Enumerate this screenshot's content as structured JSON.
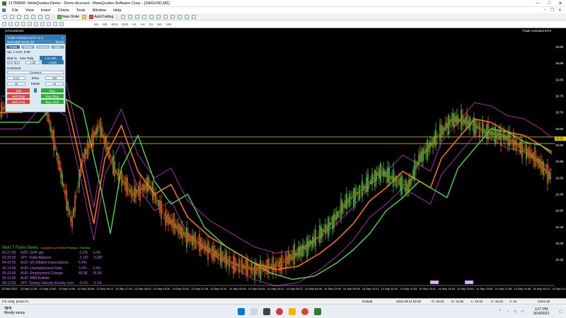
{
  "window": {
    "title": "11758965: MetaQuotes-Demo - Demo Account - MetaQuotes Software Corp. - [XAGUSD,M1]"
  },
  "menu": [
    "File",
    "View",
    "Insert",
    "Charts",
    "Tools",
    "Window",
    "Help"
  ],
  "toolbar": {
    "new_order": "New Order",
    "autotrading": "AutoTrading",
    "timeframes": [
      "M1",
      "M5",
      "M15",
      "M30",
      "H1",
      "H4",
      "D1",
      "W1",
      "MN"
    ]
  },
  "chart": {
    "symbol_label": "XAGUSD,M1",
    "assistant_label": "Trade Assistant MT4",
    "current_price_tag": "19.62",
    "price_labels": [
      "19.90",
      "19.85",
      "19.80",
      "19.75",
      "19.70",
      "19.65",
      "19.60",
      "19.55",
      "19.50",
      "19.45",
      "19.40",
      "19.35",
      "19.30",
      "19.25"
    ],
    "time_labels": [
      "13 Sep 2022",
      "13 Sep 11:00",
      "13 Sep 13:00",
      "13 Sep 14:04",
      "13 Sep 15:08",
      "13 Sep 16:12",
      "13 Sep 17:16",
      "13 Sep 18:20",
      "13 Sep 19:25",
      "13 Sep 20:31",
      "13 Sep 21:39",
      "13 Sep 22:47",
      "14 Sep 02:00",
      "14 Sep 03:04",
      "14 Sep 04:12",
      "14 Sep 05:27",
      "14 Sep 06:49",
      "14 Sep 07:59",
      "14 Sep 09:05",
      "14 Sep 10:13",
      "14 Sep 11:20",
      "14 Sep 12:33",
      "14 Sep 13:41",
      "14 Sep 14:45",
      "14 Sep 15:49",
      "14 Sep 16:53",
      "14 Sep 17:58",
      "14 Sep 19:05",
      "14 Sep 20:13",
      "14 Sep 21:21"
    ],
    "time_badges": [
      "08:30",
      "08:30"
    ],
    "colors": {
      "background": "#000000",
      "bull": "#4cd94c",
      "bear": "#ff6a1a",
      "ma_fast": "#ff6a1a",
      "ma_trend": "#4cd94c",
      "envelope": "#cc33cc",
      "hline": "#e6d200"
    }
  },
  "trade_assistant": {
    "title": "Trade Assistant MT4 v2.3",
    "symbol": "XAGUSD 19.61 (0)",
    "spread": "62.15",
    "tabs": [
      "Trade",
      "Close",
      "Settings",
      "Info"
    ],
    "spread_line": "Sp: 1  Com: 0.00",
    "risk_label": "Risk %",
    "risk_value": "1.0",
    "rr_value": "0.0",
    "size_label": "Size Toliq",
    "size_value": "1.00",
    "lot_calc": "Lot calc",
    "lines": "Lines",
    "comment_label": "Comment",
    "comment_value": "Comment",
    "entry_left": "0.24",
    "entry_label": "Entry",
    "entry_value": "200",
    "points_left": "42",
    "points_label": "Points",
    "points_value": "14",
    "sell": "Sell",
    "buy": "Buy",
    "sell_stop": "Sell Stop",
    "buy_stop": "Buy Stop",
    "sell_limit": "Sell Limit",
    "buy_limit": "Buy Limit"
  },
  "news": {
    "title": "Next 7 Forex News",
    "credit_prefix": "Copyrights by SetWtbp",
    "credit_suffix": "Precision - Forecast",
    "rows": [
      {
        "time": "02:27:55",
        "event": "NZD: GDP q/q",
        "actual": "-0.2%",
        "forecast": "1.0%"
      },
      {
        "time": "03:32:55",
        "event": "JPY: Trade Balance",
        "actual": "-2.13T",
        "forecast": "-2.08T"
      },
      {
        "time": "04:42:56",
        "event": "AUD: MI Inflation Expectations",
        "actual": "5.9%",
        "forecast": ""
      },
      {
        "time": "05:12:56",
        "event": "AUD: Unemployment Rate",
        "actual": "3.4%",
        "forecast": "3.4%"
      },
      {
        "time": "05:12:56",
        "event": "AUD: Employment Change",
        "actual": "40.9K",
        "forecast": "35.5K"
      },
      {
        "time": "05:12:56",
        "event": "AUD: RBA Bulletin",
        "actual": "",
        "forecast": ""
      },
      {
        "time": "08:12:56",
        "event": "JPY: Tertiary Industry Activity m/m",
        "actual": "-0.2%",
        "forecast": "-0.1%"
      }
    ]
  },
  "status": {
    "help": "For Help, press F1",
    "profile": "Default",
    "datetime": "2022.09.14 08:30",
    "open": "O: 19.34",
    "high": "H: 19.35",
    "low": "L: 19.34",
    "close": "C: 19.34",
    "volume": "V: 16",
    "traffic": "223/1 kb"
  },
  "taskbar": {
    "temp": "76°F",
    "weather": "Mostly sunny",
    "time": "3:17 PM",
    "date": "9/14/2022"
  }
}
